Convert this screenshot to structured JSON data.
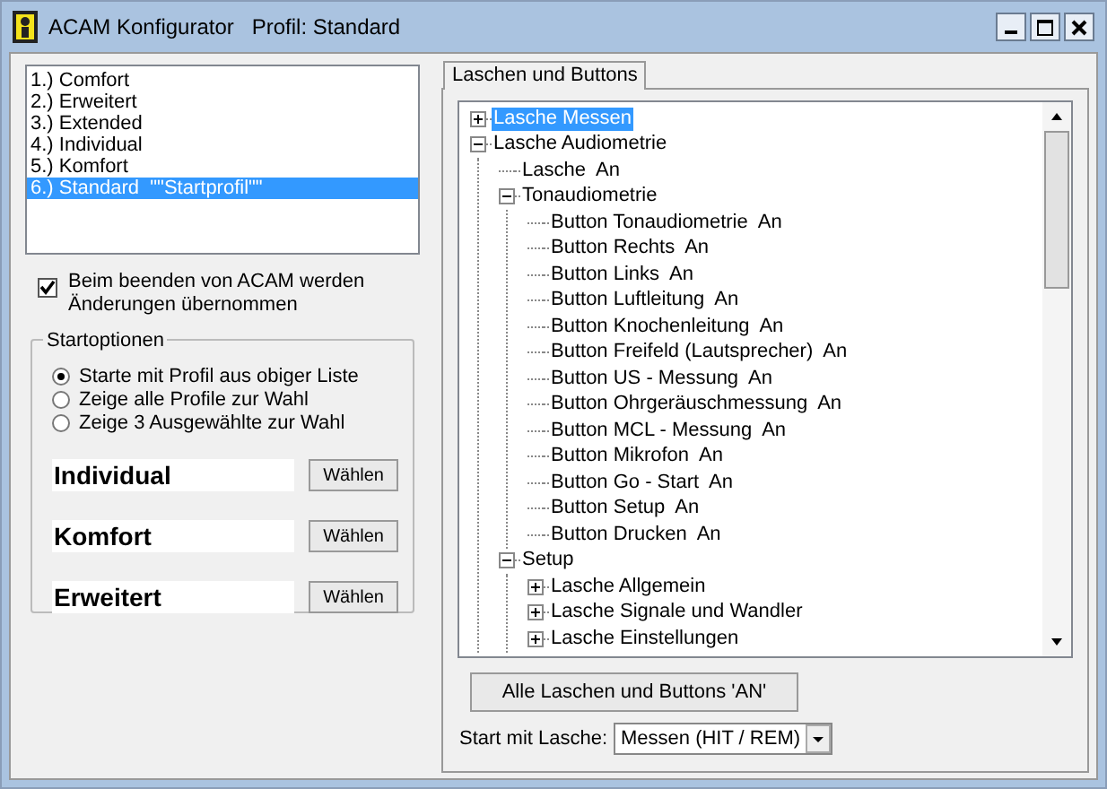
{
  "window": {
    "title": "ACAM Konfigurator   Profil: Standard"
  },
  "profiles": [
    {
      "label": "1.) Comfort",
      "selected": false
    },
    {
      "label": "2.) Erweitert",
      "selected": false
    },
    {
      "label": "3.) Extended",
      "selected": false
    },
    {
      "label": "4.) Individual",
      "selected": false
    },
    {
      "label": "5.) Komfort",
      "selected": false
    },
    {
      "label": "6.) Standard  \"\"Startprofil\"\"",
      "selected": true
    }
  ],
  "save_on_exit": {
    "label": "Beim beenden von ACAM werden Änderungen übernommen",
    "checked": true
  },
  "start_options": {
    "title": "Startoptionen",
    "options": [
      {
        "label": "Starte mit Profil aus obiger Liste",
        "selected": true
      },
      {
        "label": "Zeige alle Profile zur Wahl",
        "selected": false
      },
      {
        "label": "Zeige 3 Ausgewählte zur Wahl",
        "selected": false
      }
    ],
    "slots": [
      {
        "value": "Individual",
        "button": "Wählen"
      },
      {
        "value": "Komfort",
        "button": "Wählen"
      },
      {
        "value": "Erweitert",
        "button": "Wählen"
      }
    ]
  },
  "tabs": [
    {
      "label": "Laschen und Buttons",
      "selected": true
    }
  ],
  "tree": [
    {
      "label": "Lasche Messen",
      "selected": true,
      "expanded": false
    },
    {
      "label": "Lasche Audiometrie",
      "selected": false,
      "expanded": true,
      "children": [
        {
          "label": "Lasche  An",
          "selected": false
        },
        {
          "label": "Tonaudiometrie",
          "selected": false,
          "expanded": true,
          "children": [
            {
              "label": "Button Tonaudiometrie  An",
              "selected": false
            },
            {
              "label": "Button Rechts  An",
              "selected": false
            },
            {
              "label": "Button Links  An",
              "selected": false
            },
            {
              "label": "Button Luftleitung  An",
              "selected": false
            },
            {
              "label": "Button Knochenleitung  An",
              "selected": false
            },
            {
              "label": "Button Freifeld (Lautsprecher)  An",
              "selected": false
            },
            {
              "label": "Button US - Messung  An",
              "selected": false
            },
            {
              "label": "Button Ohrgeräuschmessung  An",
              "selected": false
            },
            {
              "label": "Button MCL - Messung  An",
              "selected": false
            },
            {
              "label": "Button Mikrofon  An",
              "selected": false
            },
            {
              "label": "Button Go - Start  An",
              "selected": false
            },
            {
              "label": "Button Setup  An",
              "selected": false
            },
            {
              "label": "Button Drucken  An",
              "selected": false
            }
          ]
        },
        {
          "label": "Setup",
          "selected": false,
          "expanded": true,
          "children": [
            {
              "label": "Lasche Allgemein",
              "selected": false,
              "expanded": false
            },
            {
              "label": "Lasche Signale und Wandler",
              "selected": false,
              "expanded": false
            },
            {
              "label": "Lasche Einstellungen",
              "selected": false,
              "expanded": false
            }
          ]
        }
      ]
    }
  ],
  "all_on_button": "Alle Laschen und Buttons 'AN'",
  "start_tab": {
    "label": "Start mit Lasche:",
    "value": "Messen (HIT / REM)"
  }
}
